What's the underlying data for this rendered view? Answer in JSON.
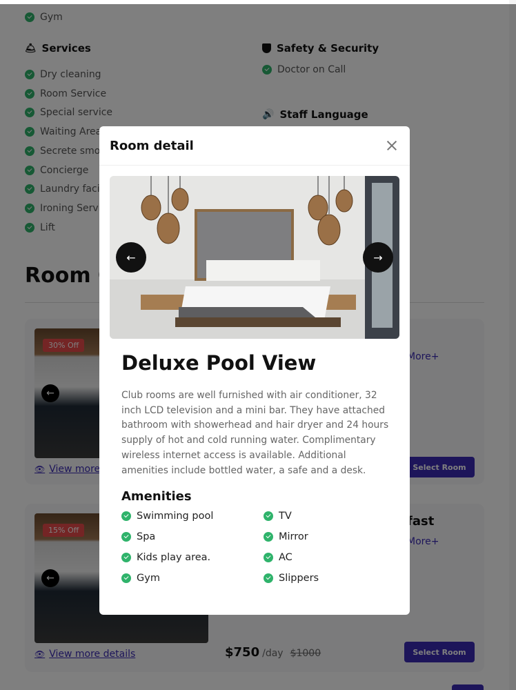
{
  "background": {
    "top_item": "Gym",
    "services": {
      "heading": "Services",
      "items": [
        "Dry cleaning",
        "Room Service",
        "Special service",
        "Waiting Area",
        "Secrete smok",
        "Concierge",
        "Laundry facil",
        "Ironing Servic",
        "Lift"
      ]
    },
    "safety": {
      "heading": "Safety & Security",
      "items": [
        "Doctor on Call"
      ]
    },
    "staff_language": {
      "heading": "Staff Language"
    },
    "section_title": "Room C",
    "cards": [
      {
        "badge": "30% Off",
        "view_more": "View more",
        "more_link": "More+",
        "select_label": "Select Room"
      },
      {
        "badge": "15% Off",
        "view_more": "View more details",
        "title_fragment": "fast",
        "more_link": "More+",
        "select_label": "Select Room",
        "price": "$750",
        "per": "/day",
        "old_price": "$1000"
      }
    ]
  },
  "modal": {
    "title": "Room detail",
    "room_name": "Deluxe Pool View",
    "description": "Club rooms are well furnished with air conditioner, 32 inch LCD television and a mini bar. They have attached bathroom with showerhead and hair dryer and 24 hours supply of hot and cold running water. Complimentary wireless internet access is available. Additional amenities include bottled water, a safe and a desk.",
    "amenities_title": "Amenities",
    "amenities": [
      "Swimming pool",
      "TV",
      "Spa",
      "Mirror",
      "Kids play area.",
      "AC",
      "Gym",
      "Slippers"
    ],
    "prev_icon": "arrow-left-icon",
    "next_icon": "arrow-right-icon"
  },
  "colors": {
    "accent": "#3b2bb5",
    "check": "#2fb36b",
    "badge": "#e84a4a",
    "overlay": "rgba(0,0,0,0.5)"
  }
}
